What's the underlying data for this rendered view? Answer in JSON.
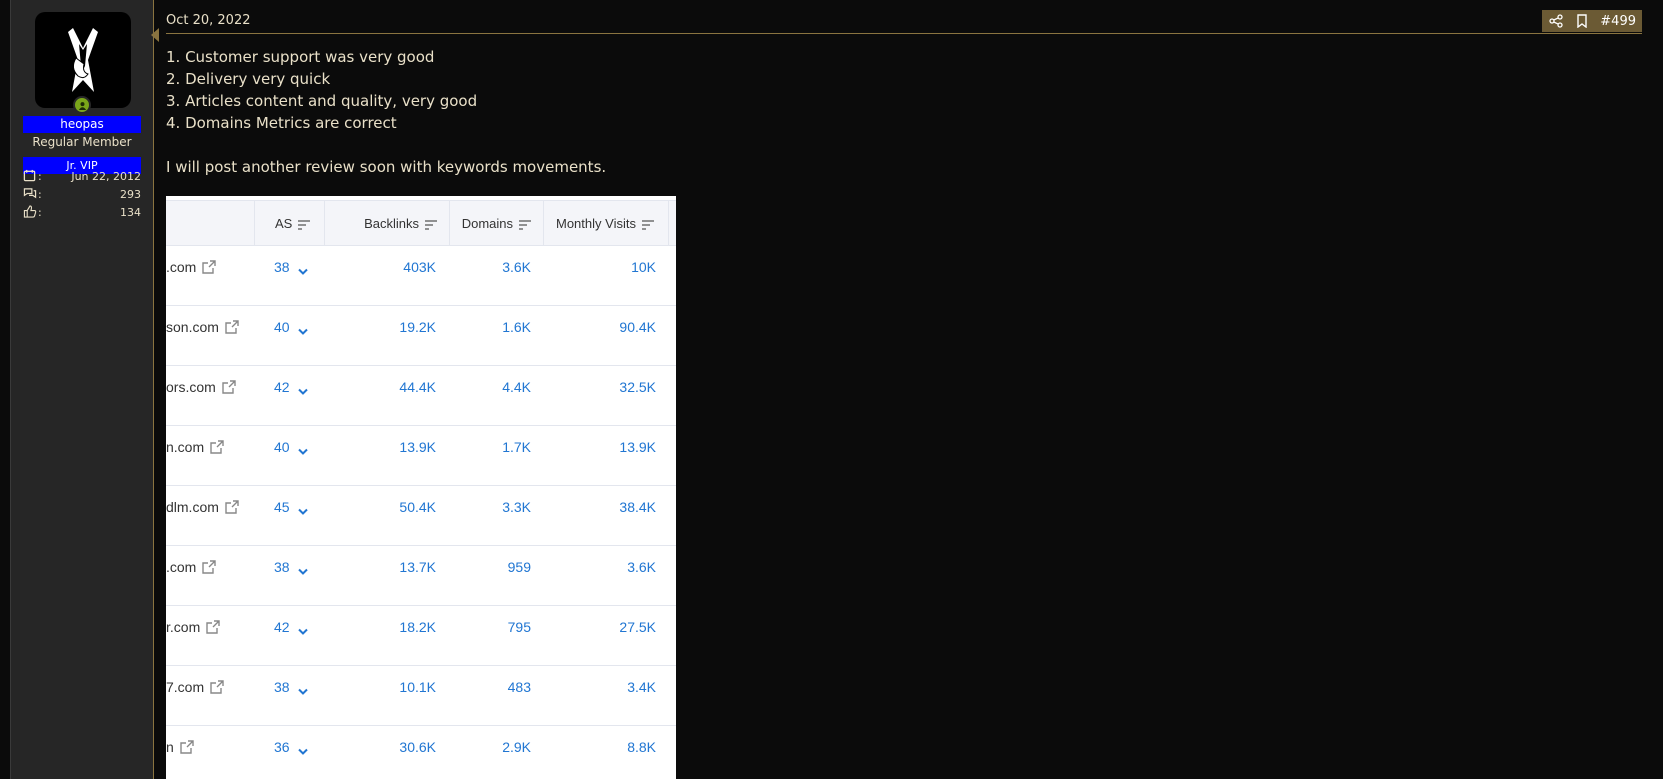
{
  "user": {
    "username": "heopas",
    "title": "Regular Member",
    "banner": "Jr. VIP",
    "stats": [
      {
        "icon": "calendar-icon",
        "value": "Jun 22, 2012"
      },
      {
        "icon": "messages-icon",
        "value": "293"
      },
      {
        "icon": "thumbs-up-icon",
        "value": "134"
      }
    ],
    "stat_colon": ":"
  },
  "post": {
    "date": "Oct 20, 2022",
    "number": "#499",
    "lines": [
      "1. Customer support was very good",
      "2. Delivery very quick",
      "3. Articles content and quality, very good",
      "4. Domains Metrics are correct"
    ],
    "closing": "I will post another review soon with keywords movements."
  },
  "table": {
    "headers": {
      "as": "AS",
      "backlinks": "Backlinks",
      "domains": "Domains",
      "visits": "Monthly Visits"
    },
    "rows": [
      {
        "domain": ".com",
        "as": "38",
        "backlinks": "403K",
        "domains": "3.6K",
        "visits": "10K"
      },
      {
        "domain": "son.com",
        "as": "40",
        "backlinks": "19.2K",
        "domains": "1.6K",
        "visits": "90.4K"
      },
      {
        "domain": "ors.com",
        "as": "42",
        "backlinks": "44.4K",
        "domains": "4.4K",
        "visits": "32.5K"
      },
      {
        "domain": "n.com",
        "as": "40",
        "backlinks": "13.9K",
        "domains": "1.7K",
        "visits": "13.9K"
      },
      {
        "domain": "dlm.com",
        "as": "45",
        "backlinks": "50.4K",
        "domains": "3.3K",
        "visits": "38.4K"
      },
      {
        "domain": ".com",
        "as": "38",
        "backlinks": "13.7K",
        "domains": "959",
        "visits": "3.6K"
      },
      {
        "domain": "r.com",
        "as": "42",
        "backlinks": "18.2K",
        "domains": "795",
        "visits": "27.5K"
      },
      {
        "domain": "7.com",
        "as": "38",
        "backlinks": "10.1K",
        "domains": "483",
        "visits": "3.4K"
      },
      {
        "domain": "n",
        "as": "36",
        "backlinks": "30.6K",
        "domains": "2.9K",
        "visits": "8.8K"
      }
    ]
  },
  "colors": {
    "accent_border": "#8a7440",
    "username_bg": "#0000ff",
    "link_blue": "#2176d2",
    "online": "#7aa61a"
  }
}
